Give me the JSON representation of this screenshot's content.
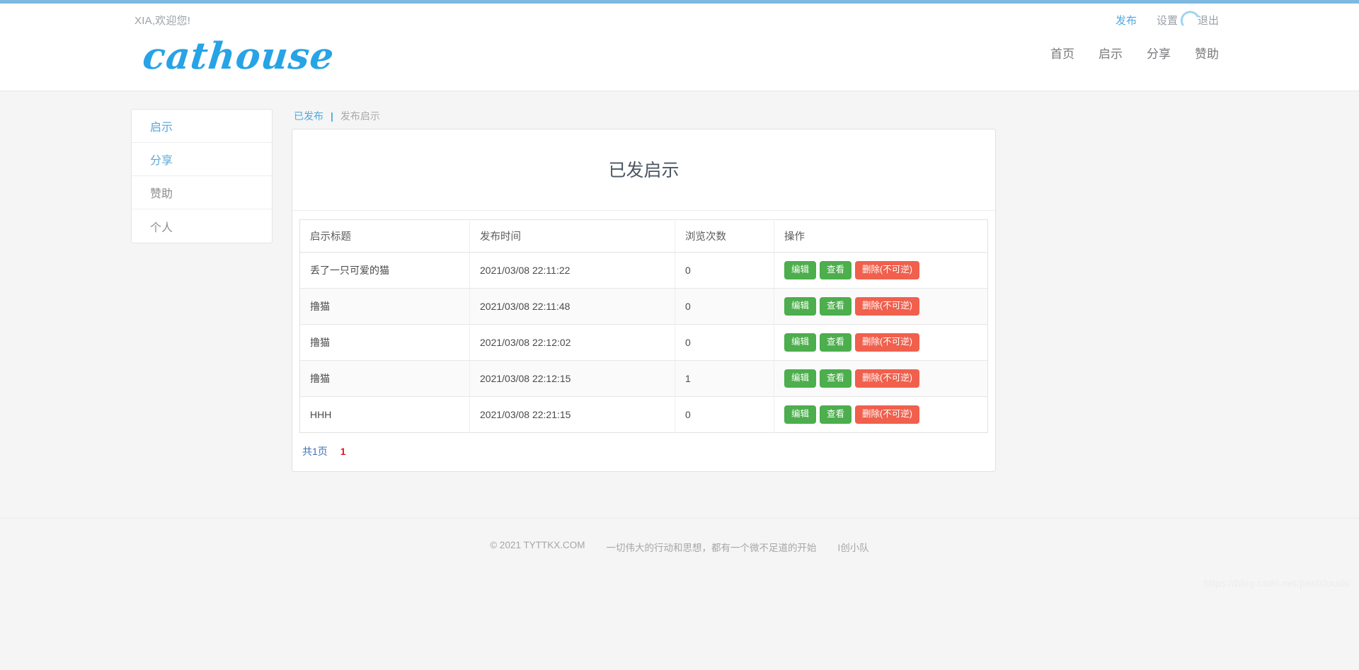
{
  "colors": {
    "brand_blue": "#27a3e6",
    "top_bar": "#7fb9e0",
    "link_blue": "#4fa8e0",
    "green": "#4cae4c",
    "red": "#f0604d",
    "pager_red": "#e01b1b",
    "muted_gray": "#9aa0a6"
  },
  "header": {
    "welcome": "XIA,欢迎您!",
    "brand": "cathouse",
    "util_nav": [
      {
        "label": "发布",
        "active": true
      },
      {
        "label": "设置",
        "active": false
      },
      {
        "label": "退出",
        "active": false
      }
    ],
    "main_nav": [
      {
        "label": "首页"
      },
      {
        "label": "启示"
      },
      {
        "label": "分享"
      },
      {
        "label": "赞助"
      }
    ],
    "spinner": "loading-spinner-icon"
  },
  "sidebar": {
    "items": [
      {
        "label": "启示",
        "tone": "blue"
      },
      {
        "label": "分享",
        "tone": "blue"
      },
      {
        "label": "赞助",
        "tone": "gray"
      },
      {
        "label": "个人",
        "tone": "gray"
      }
    ]
  },
  "breadcrumb": {
    "active": "已发布",
    "separator": "|",
    "inactive": "发布启示"
  },
  "panel": {
    "title": "已发启示",
    "table": {
      "headers": [
        "启示标题",
        "发布时间",
        "浏览次数",
        "操作"
      ],
      "rows": [
        {
          "title": "丢了一只可爱的猫",
          "time": "2021/03/08 22:11:22",
          "views": "0",
          "actions": [
            "编辑",
            "查看",
            "删除(不可逆)"
          ]
        },
        {
          "title": "撸猫",
          "time": "2021/03/08 22:11:48",
          "views": "0",
          "actions": [
            "编辑",
            "查看",
            "删除(不可逆)"
          ]
        },
        {
          "title": "撸猫",
          "time": "2021/03/08 22:12:02",
          "views": "0",
          "actions": [
            "编辑",
            "查看",
            "删除(不可逆)"
          ]
        },
        {
          "title": "撸猫",
          "time": "2021/03/08 22:12:15",
          "views": "1",
          "actions": [
            "编辑",
            "查看",
            "删除(不可逆)"
          ]
        },
        {
          "title": "HHH",
          "time": "2021/03/08 22:21:15",
          "views": "0",
          "actions": [
            "编辑",
            "查看",
            "删除(不可逆)"
          ]
        }
      ]
    },
    "pager": {
      "total_label": "共1页",
      "current_page": "1"
    }
  },
  "footer": {
    "copyright": "© 2021 TYTTKX.COM",
    "slogan": "一切伟大的行动和思想，都有一个微不足道的开始",
    "team": "I创小队"
  },
  "watermark": "https://blog.csdn.net/pastclouds"
}
